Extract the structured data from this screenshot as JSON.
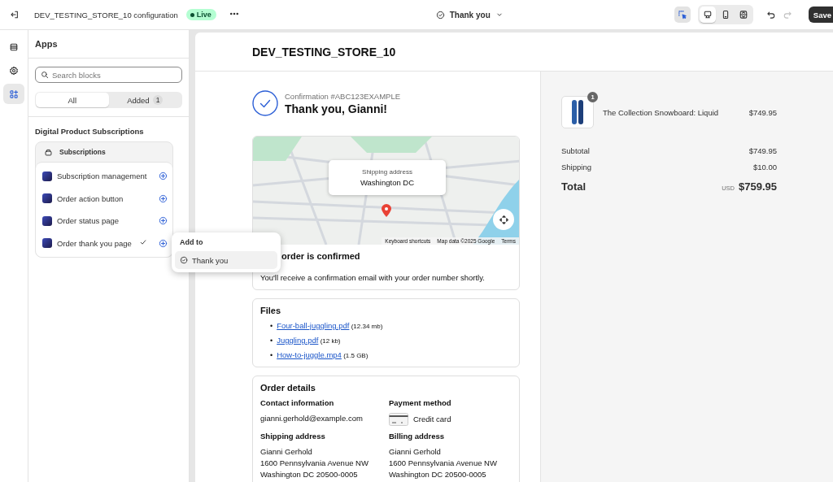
{
  "top_bar": {
    "title": "DEV_TESTING_STORE_10 configuration",
    "status": "Live",
    "page_selector": "Thank you",
    "inspector_on": true,
    "view_buttons": [
      {
        "kind": "desktop",
        "selected": true
      },
      {
        "kind": "mobile",
        "selected": false
      },
      {
        "kind": "fullscreen",
        "selected": false
      }
    ],
    "undo": {
      "disabled": false
    },
    "redo": {
      "disabled": true
    },
    "save_button": "Save"
  },
  "rail": [
    {
      "kind": "sections",
      "selected": false
    },
    {
      "kind": "settings",
      "selected": false
    },
    {
      "kind": "apps",
      "selected": true
    }
  ],
  "panel": {
    "title": "Apps",
    "search": {
      "placeholder": "Search blocks"
    },
    "filter_tabs": [
      {
        "label": "All",
        "selected": true
      },
      {
        "label": "Added",
        "count": "1",
        "selected": false
      }
    ],
    "section_title": "Digital Product Subscriptions",
    "group": {
      "title": "Subscriptions",
      "blocks": [
        {
          "label": "Subscription management",
          "added": false
        },
        {
          "label": "Order action button",
          "added": false
        },
        {
          "label": "Order status page",
          "added": false
        },
        {
          "label": "Order thank you page",
          "added": true
        }
      ]
    }
  },
  "add_to_menu": {
    "title": "Add to",
    "items": [
      {
        "label": "Thank you"
      }
    ]
  },
  "preview": {
    "store_name": "DEV_TESTING_STORE_10",
    "confirmation": "Confirmation #ABC123EXAMPLE",
    "greeting": "Thank you, Gianni!",
    "map": {
      "popup_label": "Shipping address",
      "popup_value": "Washington DC",
      "attribution": [
        "Keyboard shortcuts",
        "Map data ©2025 Google",
        "Terms"
      ]
    },
    "confirmed": {
      "title": "order is confirmed",
      "message": "You'll receive a confirmation email with your order number shortly."
    },
    "files": {
      "title": "Files",
      "items": [
        {
          "marker": "•",
          "name": "Four-ball-juggling.pdf",
          "size": "(12.34 mb)"
        },
        {
          "marker": "•",
          "name": "Juggling.pdf",
          "size": "(12 kb)"
        },
        {
          "marker": "•",
          "name": "How-to-juggle.mp4",
          "size": "(1.5 GB)"
        }
      ]
    },
    "order_details": {
      "title": "Order details",
      "sections": [
        {
          "kind": "text",
          "heading": "Contact information",
          "lines": [
            "gianni.gerhold@example.com"
          ]
        },
        {
          "kind": "payment",
          "heading": "Payment method",
          "lines": [
            "Credit card"
          ]
        },
        {
          "kind": "text",
          "heading": "Shipping address",
          "lines": [
            "Gianni Gerhold",
            "1600 Pennsylvania Avenue NW",
            "Washington DC 20500-0005"
          ]
        },
        {
          "kind": "text",
          "heading": "Billing address",
          "lines": [
            "Gianni Gerhold",
            "1600 Pennsylvania Avenue NW",
            "Washington DC 20500-0005"
          ]
        }
      ]
    },
    "summary": {
      "items": [
        {
          "name": "The Collection Snowboard: Liquid",
          "quantity": "1",
          "price": "$749.95"
        }
      ],
      "lines": [
        {
          "label": "Subtotal",
          "value": "$749.95"
        },
        {
          "label": "Shipping",
          "value": "$10.00"
        }
      ],
      "total": {
        "label": "Total",
        "currency": "USD",
        "value": "$759.95"
      }
    }
  }
}
